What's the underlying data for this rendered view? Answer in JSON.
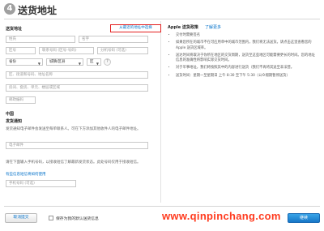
{
  "header": {
    "step_number": "4",
    "title": "送货地址"
  },
  "form": {
    "section_title": "送货地址",
    "address_book_link": "从最近的地址中选择",
    "last_name_placeholder": "姓氏",
    "first_name_placeholder": "名字",
    "area_code_placeholder": "区号",
    "phone_placeholder": "联系号码 (区号-号码)",
    "extension_placeholder": "分机号码 (可选)",
    "province_value": "省份",
    "city_value": "城镇/区县",
    "district_value": "区",
    "street_placeholder": "区、街道和号码、地址名称",
    "building_placeholder": "房间、套房、单元、楼层或区域",
    "postal_placeholder": "邮政编码",
    "country": "中国",
    "notify_title": "发货通知",
    "notify_hint": "发货通知电子邮件会发送至每单联系人。可在下方添加其他收件人的电子邮件地址。",
    "email_placeholder": "电子邮件",
    "sms_hint": "请在下面输入手机号码，以接收短信了解最新发货状态。此处号码仅用于接收短信。",
    "sms_link": "有些信息短信将如何使用",
    "mobile_placeholder": "手机号码 (可选)"
  },
  "policy": {
    "title": "Apple 送货政策",
    "link": "了解更多",
    "items": [
      "交付时需要签名",
      "如果您所在的城市不在可应用单中的城市范围内，我们将无法送货。请点击这里查看您的 Apple 送货区域率。",
      "送达时间将取决于你所在地区的交货周期，送货至这些地区可能需要更长的时间。您的地址信息的准确性将影响实际交货时间。",
      "对于军事地址，我们将按照其中的内容进行送货（我们不再将其送至非法营。",
      "送货时间：星期一至星期日 上午 8:30 至下午 5:30（公众假期暂停送货）"
    ]
  },
  "footer": {
    "back_label": "取消提交",
    "save_label": "保存为我的默认送货信息",
    "continue_label": "继续"
  },
  "watermark": "www.qinpinchang.com"
}
